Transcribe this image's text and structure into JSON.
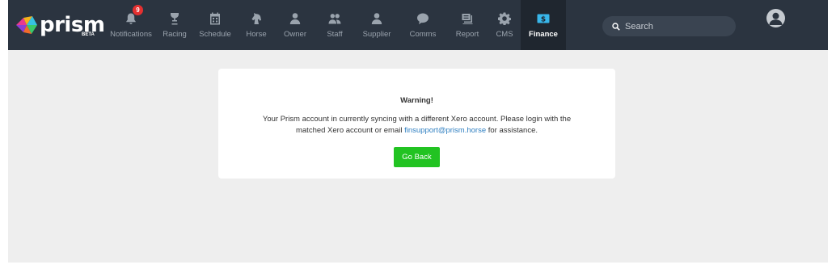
{
  "brand": {
    "name": "prism",
    "tag": "BETA"
  },
  "nav": [
    {
      "label": "Notifications",
      "icon": "bell-icon",
      "badge": "9"
    },
    {
      "label": "Racing",
      "icon": "trophy-icon"
    },
    {
      "label": "Schedule",
      "icon": "calendar-icon"
    },
    {
      "label": "Horse",
      "icon": "horse-icon"
    },
    {
      "label": "Owner",
      "icon": "user-icon"
    },
    {
      "label": "Staff",
      "icon": "users-icon"
    },
    {
      "label": "Supplier",
      "icon": "user-icon"
    },
    {
      "label": "Comms",
      "icon": "chat-icon"
    },
    {
      "label": "Report",
      "icon": "report-icon"
    },
    {
      "label": "CMS",
      "icon": "gear-icon"
    },
    {
      "label": "Finance",
      "icon": "dollar-icon",
      "active": true
    }
  ],
  "search": {
    "placeholder": "Search"
  },
  "warning": {
    "title": "Warning!",
    "message_before": "Your Prism account in currently syncing with a different Xero account. Please login with the matched Xero account or email ",
    "email": "finsupport@prism.horse",
    "message_after": " for assistance.",
    "button_label": "Go Back"
  },
  "colors": {
    "topbar": "#2b3440",
    "active_tab": "#1f262f",
    "badge": "#e53030",
    "button": "#22c322",
    "link": "#2f7fc1",
    "background": "#eeeeee"
  }
}
